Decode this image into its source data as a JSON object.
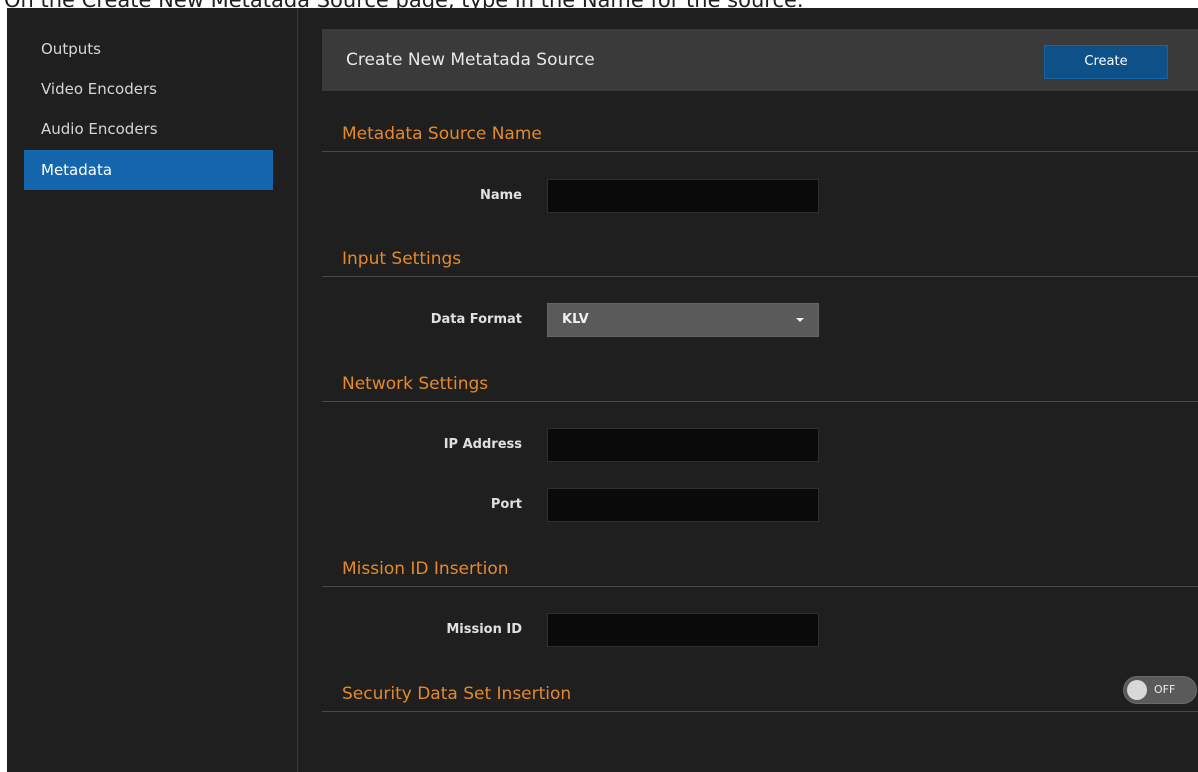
{
  "caption": "On the Create New Metatada Source page, type in the Name for the source.",
  "sidebar": {
    "items": [
      {
        "label": "Outputs",
        "active": false
      },
      {
        "label": "Video Encoders",
        "active": false
      },
      {
        "label": "Audio Encoders",
        "active": false
      },
      {
        "label": "Metadata",
        "active": true
      }
    ]
  },
  "header": {
    "title": "Create New Metatada Source",
    "create_label": "Create"
  },
  "sections": {
    "source_name": "Metadata Source Name",
    "input": "Input Settings",
    "network": "Network Settings",
    "mission": "Mission ID Insertion",
    "security": "Security Data Set Insertion"
  },
  "fields": {
    "name": {
      "label": "Name",
      "value": ""
    },
    "data_format": {
      "label": "Data Format",
      "value": "KLV"
    },
    "ip_address": {
      "label": "IP Address",
      "value": ""
    },
    "port": {
      "label": "Port",
      "value": ""
    },
    "mission_id": {
      "label": "Mission ID",
      "value": ""
    }
  },
  "security_toggle": {
    "state": "OFF"
  },
  "colors": {
    "accent_blue": "#1566ad",
    "section_orange": "#e5892a",
    "background": "#1f1f1f"
  },
  "icons": [
    "chevron-down-icon",
    "toggle-knob-icon"
  ]
}
